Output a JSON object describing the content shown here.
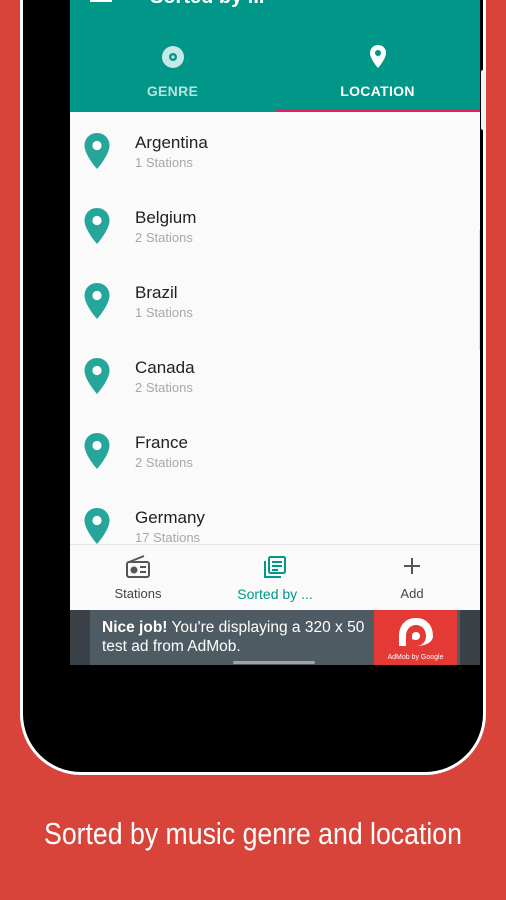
{
  "app": {
    "title": "Sorted by ..."
  },
  "tabs": [
    {
      "label": "GENRE",
      "icon": "disc-icon",
      "active": false
    },
    {
      "label": "LOCATION",
      "icon": "location-pin-icon",
      "active": true
    }
  ],
  "locations": [
    {
      "name": "Argentina",
      "count": "1 Stations"
    },
    {
      "name": "Belgium",
      "count": "2 Stations"
    },
    {
      "name": "Brazil",
      "count": "1 Stations"
    },
    {
      "name": "Canada",
      "count": "2 Stations"
    },
    {
      "name": "France",
      "count": "2 Stations"
    },
    {
      "name": "Germany",
      "count": "17 Stations"
    }
  ],
  "bottom_nav": [
    {
      "label": "Stations",
      "icon": "radio-icon",
      "active": false
    },
    {
      "label": "Sorted by ...",
      "icon": "library-icon",
      "active": true
    },
    {
      "label": "Add",
      "icon": "plus-icon",
      "active": false
    }
  ],
  "ad": {
    "bold": "Nice job!",
    "text": " You're displaying a 320 x 50 test ad from AdMob.",
    "logo_caption": "AdMob by Google"
  },
  "caption": "Sorted by music genre and location",
  "colors": {
    "background": "#d9443a",
    "primary": "#009688",
    "accent": "#e91e63",
    "pin": "#26a69a"
  }
}
